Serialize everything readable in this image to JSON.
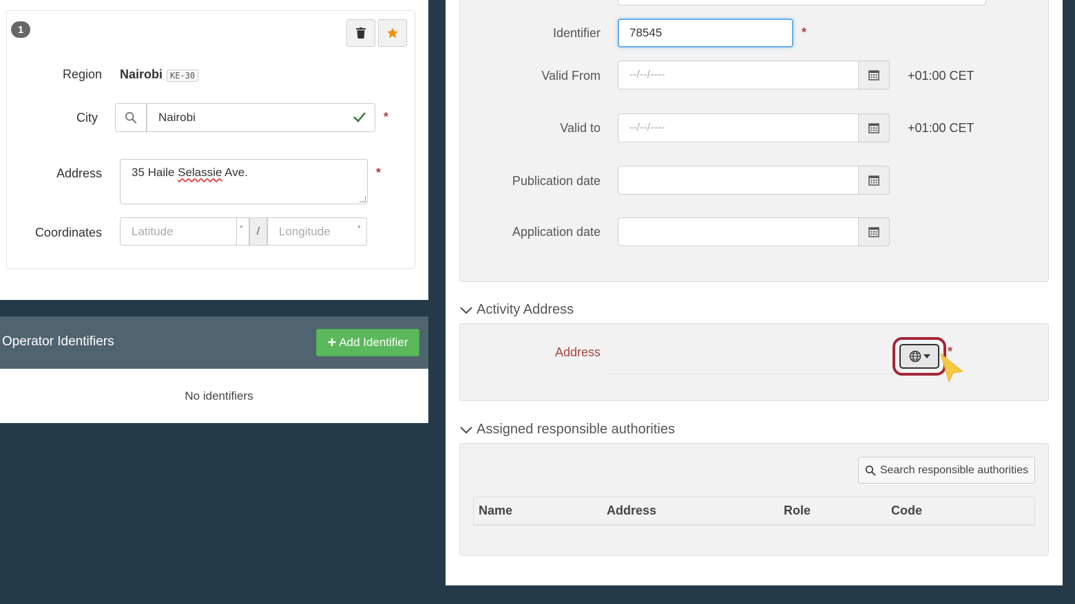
{
  "left": {
    "address_card": {
      "index_badge": "1",
      "region": {
        "label": "Region",
        "value": "Nairobi",
        "code": "KE-30"
      },
      "city": {
        "label": "City",
        "value": "Nairobi",
        "required": "*"
      },
      "address": {
        "label": "Address",
        "value_pre": "35 Haile ",
        "value_misspelled": "Selassie",
        "value_post": " Ave.",
        "required": "*"
      },
      "coordinates": {
        "label": "Coordinates",
        "lat_placeholder": "Latitude",
        "lon_placeholder": "Longitude",
        "degree": "°",
        "separator": "/"
      }
    },
    "operator_identifiers": {
      "title": "Operator Identifiers",
      "add_button": "Add Identifier",
      "add_icon": "+",
      "empty_text": "No identifiers"
    }
  },
  "right": {
    "fields": {
      "identifier": {
        "label": "Identifier",
        "value": "78545",
        "required": "*"
      },
      "valid_from": {
        "label": "Valid From",
        "placeholder": "--/--/----",
        "tz": "+01:00 CET"
      },
      "valid_to": {
        "label": "Valid to",
        "placeholder": "--/--/----",
        "tz": "+01:00 CET"
      },
      "publication_date": {
        "label": "Publication date"
      },
      "application_date": {
        "label": "Application date"
      }
    },
    "activity_address": {
      "title": "Activity Address",
      "address_label": "Address",
      "required": "*"
    },
    "authorities": {
      "title": "Assigned responsible authorities",
      "search_button": "Search responsible authorities",
      "columns": [
        "Name",
        "Address",
        "Role",
        "Code"
      ]
    }
  },
  "colors": {
    "background": "#243a48",
    "operator_header": "#50646f",
    "success_green": "#5cb85c",
    "star_orange": "#f0900c",
    "required_red": "#a94442",
    "highlight_ring": "#a32638",
    "cursor_yellow": "#f5c842"
  },
  "icons": [
    "info-number-badge",
    "trash-icon",
    "star-icon",
    "search-icon",
    "check-icon",
    "calendar-icon",
    "chevron-down-icon",
    "globe-icon",
    "caret-down-icon",
    "mouse-cursor-icon",
    "plus-icon"
  ]
}
